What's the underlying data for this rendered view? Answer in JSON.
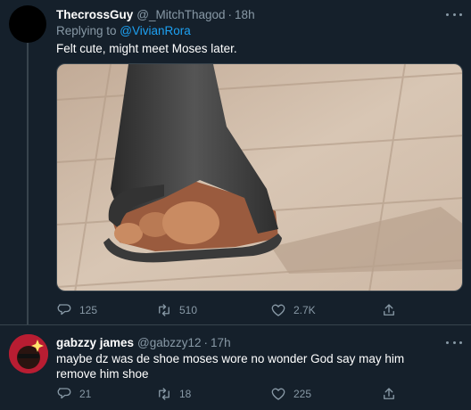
{
  "tweet": {
    "author_name": "ThecrossGuy",
    "handle": "@_MitchThagod",
    "separator": "·",
    "time": "18h",
    "replying_prefix": "Replying to ",
    "replying_to": "@VivianRora",
    "text": "Felt cute, might meet Moses later.",
    "media_icon": "photo-sandal-foot",
    "stats": {
      "replies": "125",
      "retweets": "510",
      "likes": "2.7K"
    }
  },
  "reply": {
    "author_name": "gabzzy james",
    "handle": "@gabzzy12",
    "separator": "·",
    "time": "17h",
    "text": "maybe dz was de shoe moses wore no wonder God say may him remove him shoe",
    "stats": {
      "replies": "21",
      "retweets": "18",
      "likes": "225"
    }
  },
  "colors": {
    "background": "#15202b",
    "muted": "#8899a6",
    "accent": "#1da1f2",
    "border": "#38444d"
  }
}
